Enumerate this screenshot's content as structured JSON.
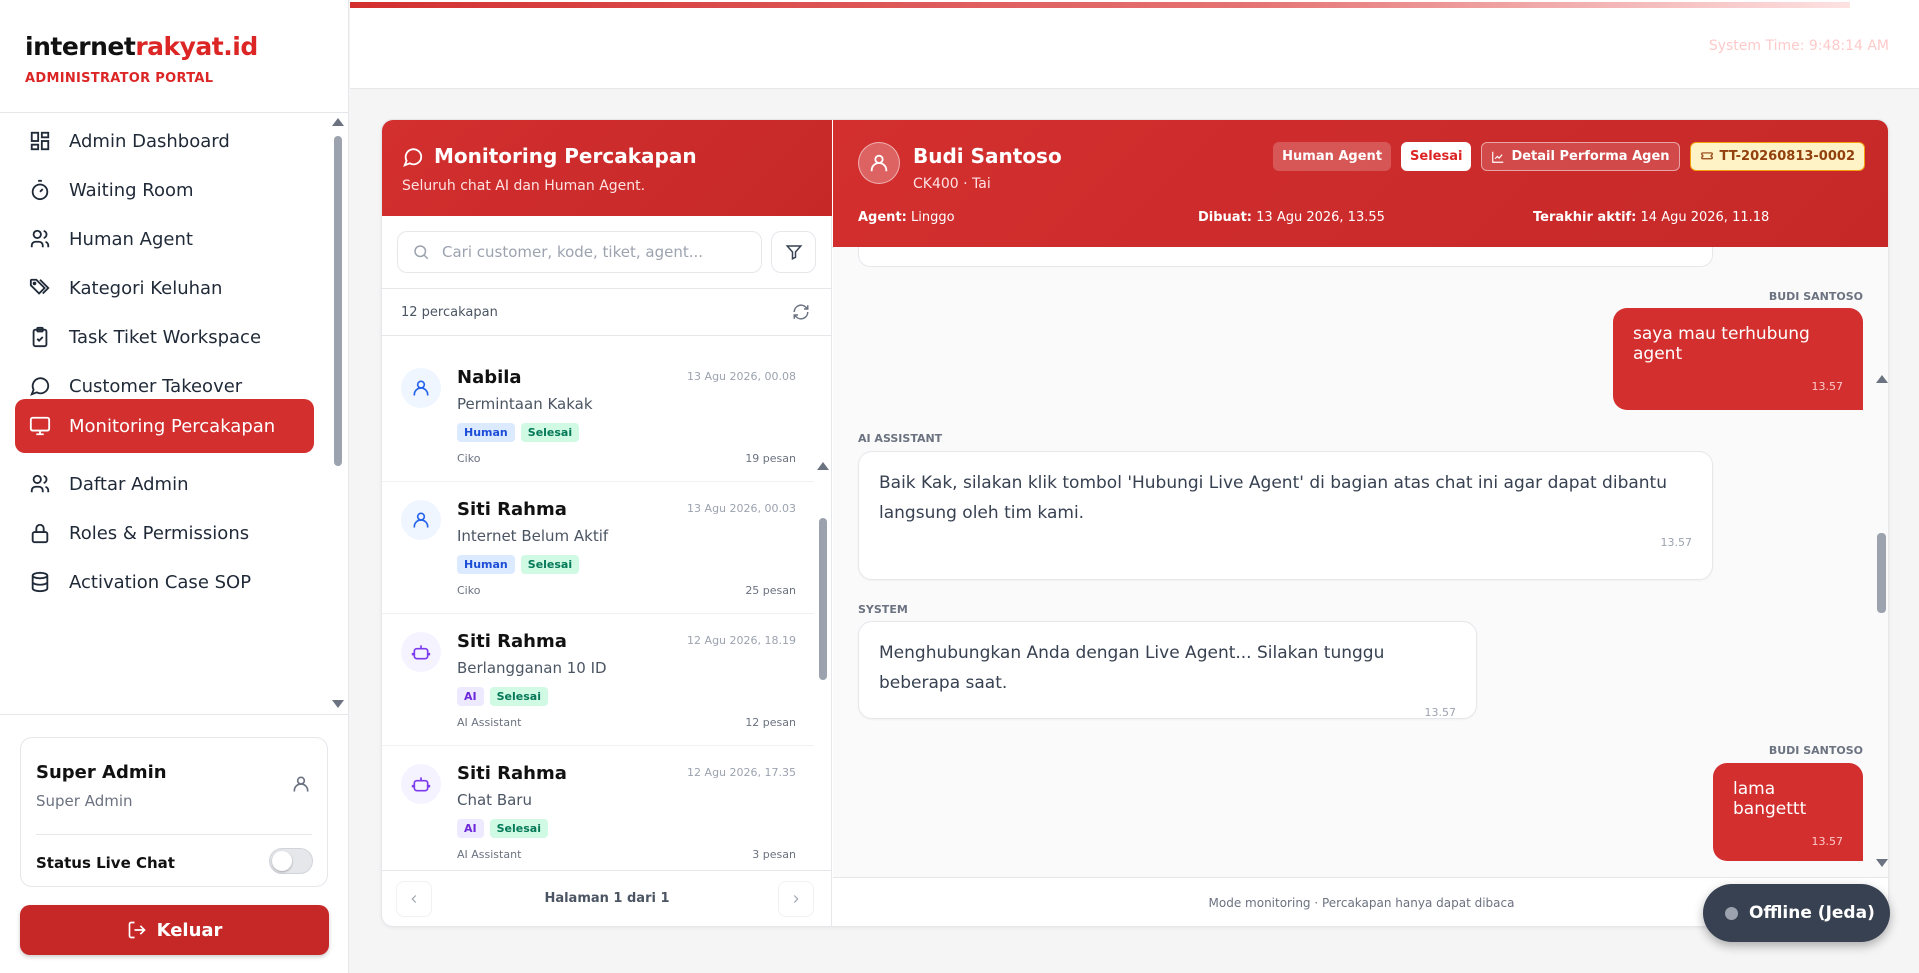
{
  "brand": {
    "name_part1": "internet",
    "name_part2": "rakyat.id",
    "subtitle": "ADMINISTRATOR PORTAL"
  },
  "topbar": {
    "system_time": "System Time: 9:48:14 AM"
  },
  "sidebar": {
    "items": [
      {
        "label": "Admin Dashboard",
        "icon": "dashboard-icon"
      },
      {
        "label": "Waiting Room",
        "icon": "timer-icon"
      },
      {
        "label": "Human Agent",
        "icon": "users-icon"
      },
      {
        "label": "Kategori Keluhan",
        "icon": "tags-icon"
      },
      {
        "label": "Task Tiket Workspace",
        "icon": "clipboard-check-icon"
      },
      {
        "label": "Customer Takeover",
        "icon": "message-circle-icon"
      },
      {
        "label": "Monitoring Percakapan",
        "icon": "monitor-icon",
        "active": true
      },
      {
        "label": "Daftar Admin",
        "icon": "users-icon"
      },
      {
        "label": "Roles & Permissions",
        "icon": "lock-icon"
      },
      {
        "label": "Activation Case SOP",
        "icon": "database-icon"
      }
    ],
    "user": {
      "name": "Super Admin",
      "role": "Super Admin",
      "live_chat_label": "Status Live Chat",
      "live_chat_on": false
    },
    "logout_label": "Keluar"
  },
  "list": {
    "title": "Monitoring Percakapan",
    "subtitle": "Seluruh chat AI dan Human Agent.",
    "search_placeholder": "Cari customer, kode, tiket, agent...",
    "count_text": "12 percakapan",
    "conversations": [
      {
        "name": "Nabila",
        "date": "13 Agu 2026, 00.08",
        "topic": "Permintaan Kakak",
        "type_tag": "Human",
        "status_tag": "Selesai",
        "agent": "Ciko",
        "messages": "19 pesan",
        "kind": "human"
      },
      {
        "name": "Siti Rahma",
        "date": "13 Agu 2026, 00.03",
        "topic": "Internet Belum Aktif",
        "type_tag": "Human",
        "status_tag": "Selesai",
        "agent": "Ciko",
        "messages": "25 pesan",
        "kind": "human"
      },
      {
        "name": "Siti Rahma",
        "date": "12 Agu 2026, 18.19",
        "topic": "Berlangganan 10 ID",
        "type_tag": "AI",
        "status_tag": "Selesai",
        "agent": "AI Assistant",
        "messages": "12 pesan",
        "kind": "ai"
      },
      {
        "name": "Siti Rahma",
        "date": "12 Agu 2026, 17.35",
        "topic": "Chat Baru",
        "type_tag": "AI",
        "status_tag": "Selesai",
        "agent": "AI Assistant",
        "messages": "3 pesan",
        "kind": "ai"
      }
    ],
    "pager_text": "Halaman 1 dari 1"
  },
  "chat": {
    "customer_name": "Budi Santoso",
    "customer_sub": "CK400 · Tai",
    "badges": {
      "type": "Human Agent",
      "status": "Selesai",
      "performance": "Detail Performa Agen",
      "ticket": "TT-20260813-0002"
    },
    "meta": {
      "agent_label": "Agent:",
      "agent_value": "Linggo",
      "created_label": "Dibuat:",
      "created_value": "13 Agu 2026, 13.55",
      "last_label": "Terakhir aktif:",
      "last_value": "14 Agu 2026, 11.18"
    },
    "messages": [
      {
        "sender": "BUDI SANTOSO",
        "text": "saya mau terhubung agent",
        "time": "13.57"
      },
      {
        "sender": "AI ASSISTANT",
        "text": "Baik Kak, silakan klik tombol 'Hubungi Live Agent' di bagian atas chat ini agar dapat dibantu langsung oleh tim kami.",
        "time": "13.57"
      },
      {
        "sender": "SYSTEM",
        "text": "Menghubungkan Anda dengan Live Agent... Silakan tunggu beberapa saat.",
        "time": "13.57"
      },
      {
        "sender": "BUDI SANTOSO",
        "text": "lama bangettt",
        "time": "13.57"
      }
    ],
    "footer": "Mode monitoring · Percakapan hanya dapat dibaca"
  },
  "status_pill": "Offline (Jeda)"
}
